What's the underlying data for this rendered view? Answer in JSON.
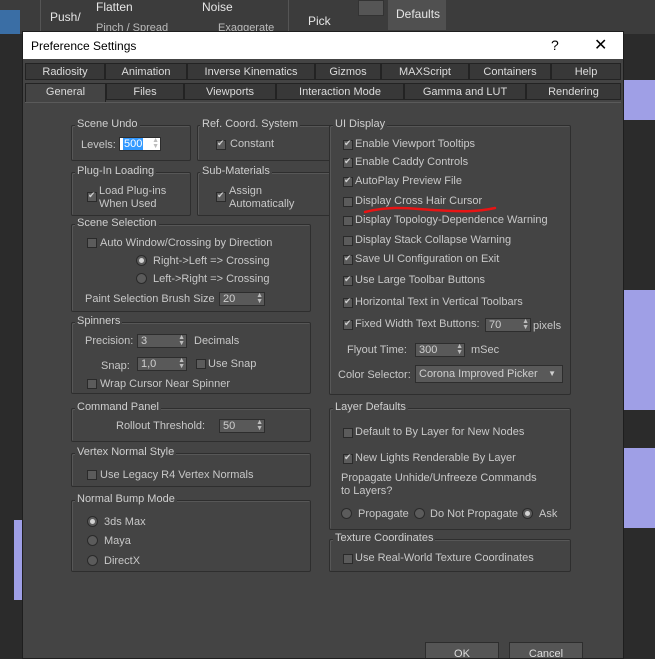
{
  "background_toolbar": {
    "pushpull": "Push/",
    "pushpull2": "Pull",
    "flatten": "Flatten",
    "noise": "Noise",
    "pinch": "Pinch / Spread",
    "exaggerate": "Exaggerate",
    "pick": "Pick",
    "defaults": "Defaults"
  },
  "dialog": {
    "title": "Preference Settings",
    "help": "?",
    "close": "✕",
    "tabs_row1": [
      "Radiosity",
      "Animation",
      "Inverse Kinematics",
      "Gizmos",
      "MAXScript",
      "Containers",
      "Help"
    ],
    "tabs_row2": [
      "General",
      "Files",
      "Viewports",
      "Interaction Mode",
      "Gamma and LUT",
      "Rendering"
    ],
    "scene_undo": {
      "title": "Scene Undo",
      "levels_label": "Levels:",
      "levels_value": "500"
    },
    "ref_coord": {
      "title": "Ref. Coord. System",
      "constant": "Constant"
    },
    "plugin_loading": {
      "title": "Plug-In Loading",
      "load_label": "Load Plug-ins",
      "load_label2": "When Used"
    },
    "sub_materials": {
      "title": "Sub-Materials",
      "assign": "Assign",
      "assign2": "Automatically"
    },
    "scene_selection": {
      "title": "Scene Selection",
      "auto_window": "Auto Window/Crossing by Direction",
      "right_left": "Right->Left => Crossing",
      "left_right": "Left->Right => Crossing",
      "paint_brush": "Paint Selection Brush Size",
      "paint_value": "20"
    },
    "spinners": {
      "title": "Spinners",
      "precision": "Precision:",
      "precision_value": "3",
      "decimals": "Decimals",
      "snap": "Snap:",
      "snap_value": "1,0",
      "use_snap": "Use Snap",
      "wrap": "Wrap Cursor Near Spinner"
    },
    "command_panel": {
      "title": "Command Panel",
      "rollout": "Rollout Threshold:",
      "rollout_value": "50"
    },
    "vertex_normal": {
      "title": "Vertex Normal Style",
      "legacy": "Use Legacy R4 Vertex Normals"
    },
    "normal_bump": {
      "title": "Normal Bump Mode",
      "opt1": "3ds Max",
      "opt2": "Maya",
      "opt3": "DirectX"
    },
    "ui_display": {
      "title": "UI Display",
      "items": [
        "Enable Viewport Tooltips",
        "Enable Caddy Controls",
        "AutoPlay Preview File",
        "Display Cross Hair Cursor",
        "Display Topology-Dependence Warning",
        "Display Stack Collapse Warning",
        "Save UI Configuration on Exit",
        "Use Large Toolbar Buttons",
        "Horizontal Text in Vertical Toolbars",
        "Fixed Width Text Buttons:"
      ],
      "fixed_width_value": "70",
      "pixels": "pixels",
      "flyout": "Flyout Time:",
      "flyout_value": "300",
      "msec": "mSec",
      "color_selector": "Color Selector:",
      "color_selector_value": "Corona Improved Picker"
    },
    "layer_defaults": {
      "title": "Layer Defaults",
      "default_bylayer": "Default to By Layer for New Nodes",
      "new_lights": "New Lights Renderable By Layer",
      "propagate_q1": "Propagate Unhide/Unfreeze Commands",
      "propagate_q2": "to Layers?",
      "propagate": "Propagate",
      "do_not": "Do Not Propagate",
      "ask": "Ask"
    },
    "texture_coords": {
      "title": "Texture Coordinates",
      "real_world": "Use Real-World Texture Coordinates"
    },
    "ok": "OK",
    "cancel": "Cancel"
  }
}
